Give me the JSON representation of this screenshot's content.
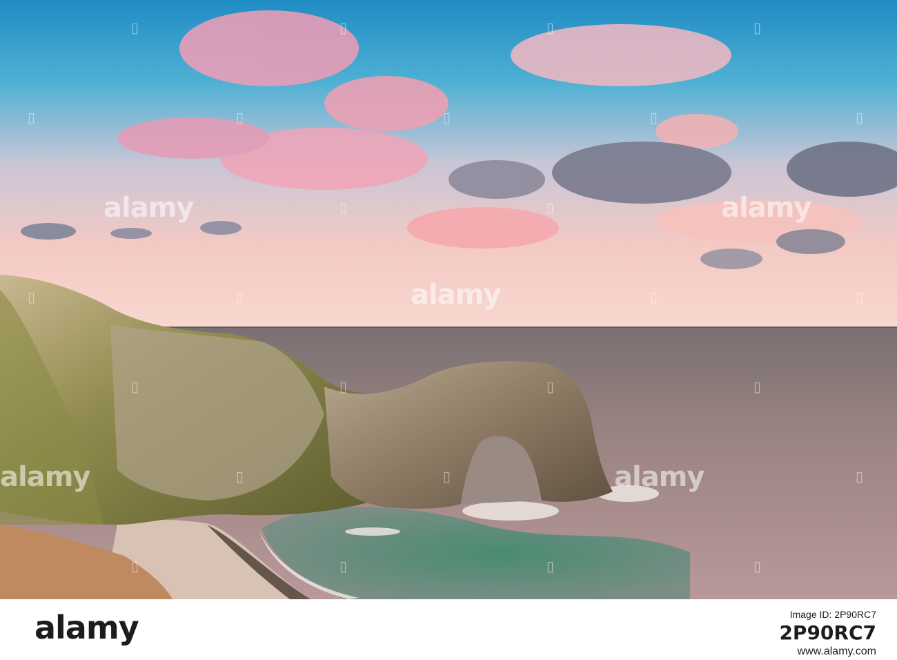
{
  "watermark": {
    "brand": "alamy"
  },
  "footer": {
    "logo": "alamy",
    "image_id_label": "Image ID: 2P90RC7",
    "image_id": "2P90RC7",
    "url": "www.alamy.com"
  },
  "colors": {
    "sky_top": "#2d95c9",
    "sky_pink": "#f5a6b0",
    "sea": "#6e6a6c",
    "lagoon": "#3d7a63",
    "rock": "#8a7560"
  }
}
